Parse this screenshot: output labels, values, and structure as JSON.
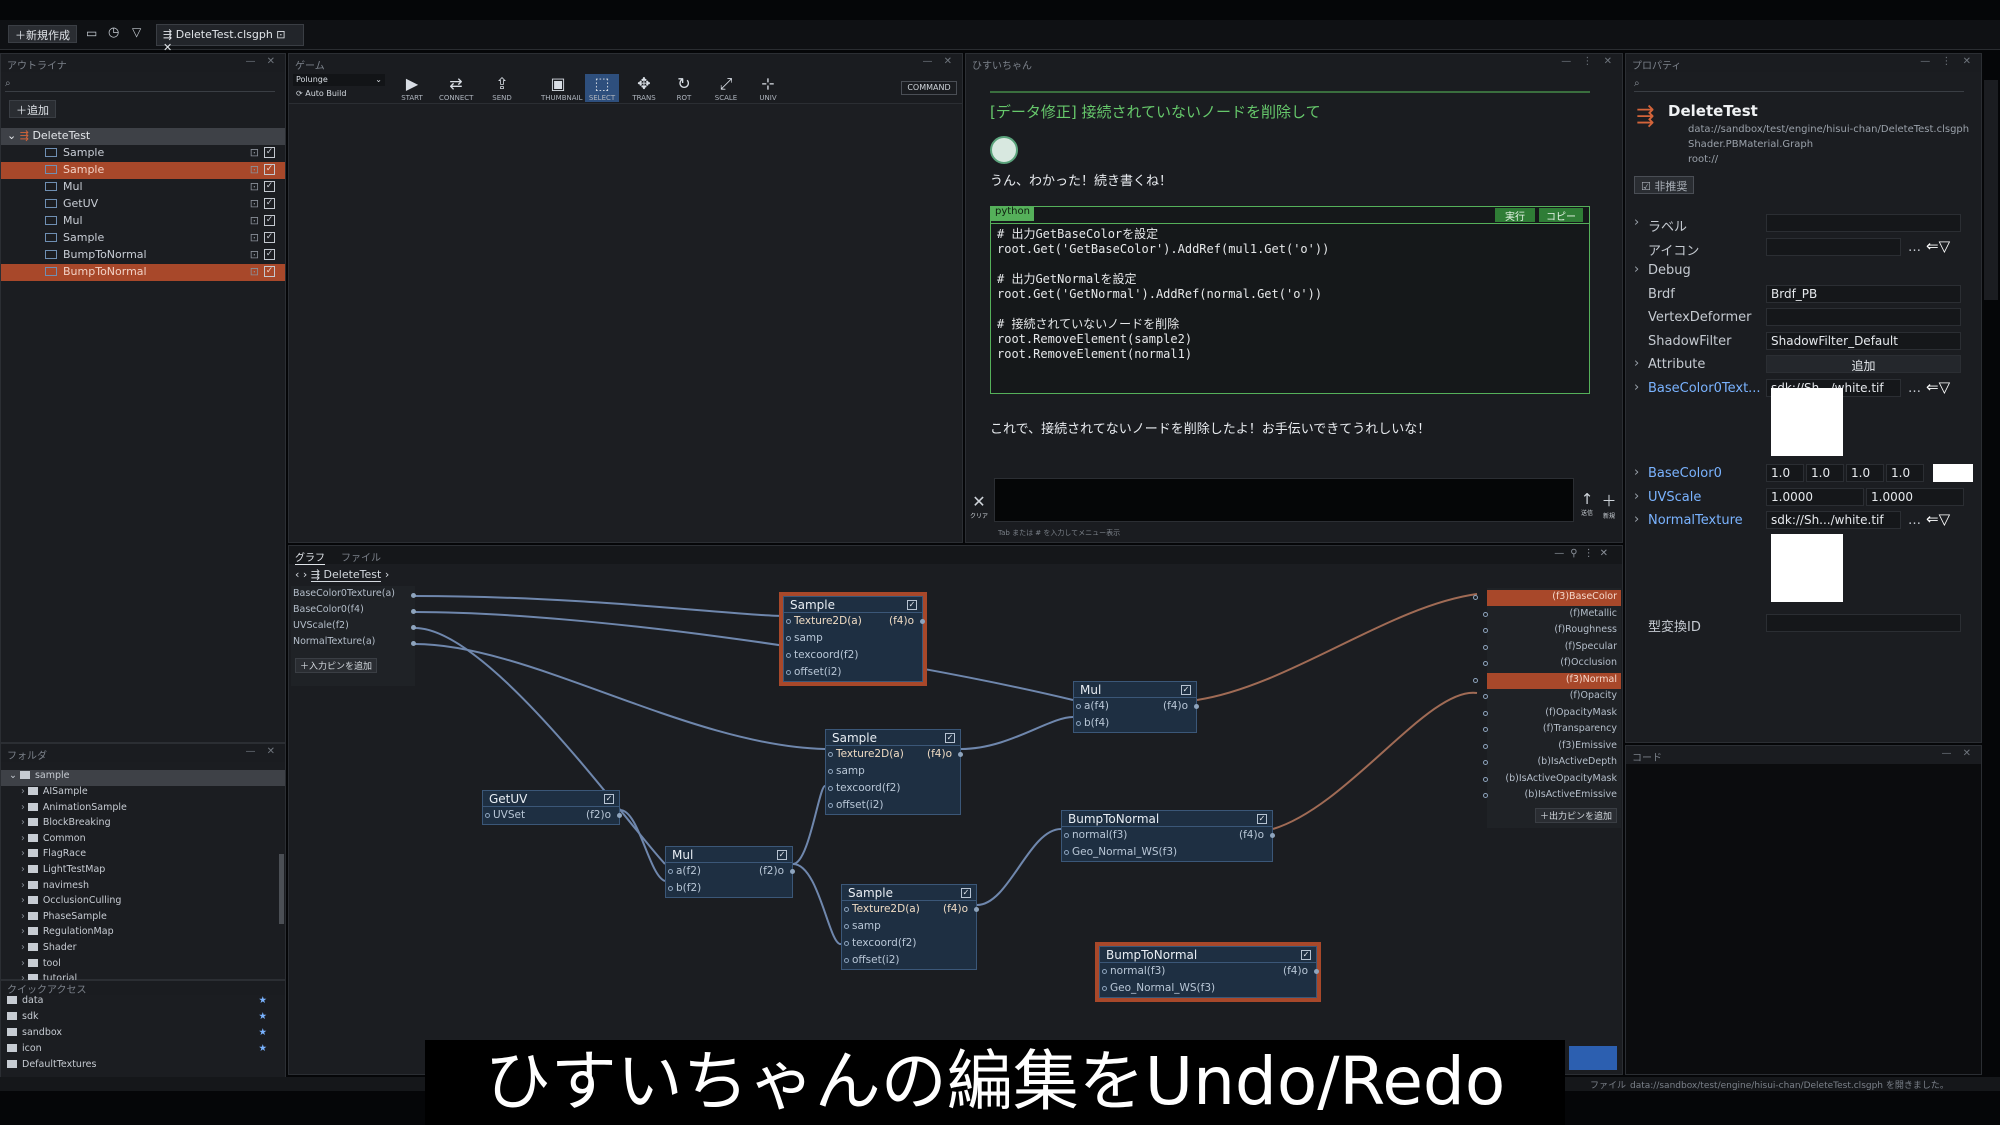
{
  "topbar": {
    "new_button": "新規作成",
    "tab_title": "DeleteTest.clsgph"
  },
  "outline": {
    "title": "アウトライナ",
    "add_button": "追加",
    "root": "DeleteTest",
    "items": [
      {
        "label": "Sample",
        "selected": false
      },
      {
        "label": "Sample",
        "selected": true
      },
      {
        "label": "Mul",
        "selected": false
      },
      {
        "label": "GetUV",
        "selected": false
      },
      {
        "label": "Mul",
        "selected": false
      },
      {
        "label": "Sample",
        "selected": false
      },
      {
        "label": "BumpToNormal",
        "selected": false
      },
      {
        "label": "BumpToNormal",
        "selected": true
      }
    ]
  },
  "game": {
    "title": "ゲーム",
    "platform": "Polunge",
    "auto_build": "Auto Build",
    "tools": [
      "START",
      "CONNECT",
      "SEND",
      "THUMBNAIL",
      "SELECT",
      "TRANS",
      "ROT",
      "SCALE",
      "UNIV"
    ],
    "command": "COMMAND"
  },
  "chat": {
    "title": "ひすいちゃん",
    "request": "[データ修正] 接続されていないノードを削除して",
    "reply1": "うん、わかった！続き書くね！",
    "code_lang": "python",
    "run_button": "実行",
    "copy_button": "コピー",
    "code": [
      "# 出力GetBaseColorを設定",
      "root.Get('GetBaseColor').AddRef(mul1.Get('o'))",
      "",
      "# 出力GetNormalを設定",
      "root.Get('GetNormal').AddRef(normal.Get('o'))",
      "",
      "# 接続されていないノードを削除",
      "root.RemoveElement(sample2)",
      "root.RemoveElement(normal1)"
    ],
    "reply2": "これで、接続されてないノードを削除したよ！お手伝いできてうれしいな！",
    "clear_label": "クリア",
    "send_label": "送信",
    "new_label": "新規",
    "input_hint": "Tab または # を入力してメニュー表示"
  },
  "properties": {
    "title": "プロパティ",
    "name": "DeleteTest",
    "path": "data://sandbox/test/engine/hisui-chan/DeleteTest.clsgph",
    "material": "Shader.PBMaterial.Graph",
    "root": "root://",
    "hide_button": "非推奨",
    "rows": [
      {
        "label": "ラベル",
        "value": ""
      },
      {
        "label": "アイコン",
        "value": ""
      },
      {
        "label": "Debug",
        "value": ""
      },
      {
        "label": "Brdf",
        "value": "Brdf_PB"
      },
      {
        "label": "VertexDeformer",
        "value": ""
      },
      {
        "label": "ShadowFilter",
        "value": "ShadowFilter_Default"
      },
      {
        "label": "Attribute",
        "value": "追加"
      },
      {
        "label": "BaseColor0Text...",
        "value": "sdk://Sh.../white.tif"
      }
    ],
    "basecolor_label": "BaseColor0",
    "basecolor_values": [
      "1.0",
      "1.0",
      "1.0",
      "1.0"
    ],
    "uvscale_label": "UVScale",
    "uvscale_values": [
      "1.0000",
      "1.0000"
    ],
    "normal_label": "NormalTexture",
    "normal_value": "sdk://Sh.../white.tif",
    "id_label": "型変換ID"
  },
  "code_panel": {
    "title": "コード"
  },
  "folder": {
    "title": "フォルダ",
    "root": "sample",
    "items": [
      "AISample",
      "AnimationSample",
      "BlockBreaking",
      "Common",
      "FlagRace",
      "LightTestMap",
      "navimesh",
      "OcclusionCulling",
      "PhaseSample",
      "RegulationMap",
      "Shader",
      "tool",
      "tutorial"
    ]
  },
  "quick": {
    "title": "クイックアクセス",
    "items": [
      "data",
      "sdk",
      "sandbox",
      "icon",
      "DefaultTextures"
    ]
  },
  "graph": {
    "tab_graph": "グラフ",
    "tab_file": "ファイル",
    "breadcrumb": "DeleteTest",
    "inputs": [
      "BaseColor0Texture(a)",
      "BaseColor0(f4)",
      "UVScale(f2)",
      "NormalTexture(a)"
    ],
    "add_input": "入力ピンを追加",
    "outputs": [
      {
        "label": "(f3)BaseColor",
        "hi": true
      },
      {
        "label": "(f)Metallic",
        "hi": false
      },
      {
        "label": "(f)Roughness",
        "hi": false
      },
      {
        "label": "(f)Specular",
        "hi": false
      },
      {
        "label": "(f)Occlusion",
        "hi": false
      },
      {
        "label": "(f3)Normal",
        "hi": true
      },
      {
        "label": "(f)Opacity",
        "hi": false
      },
      {
        "label": "(f)OpacityMask",
        "hi": false
      },
      {
        "label": "(f)Transparency",
        "hi": false
      },
      {
        "label": "(f3)Emissive",
        "hi": false
      },
      {
        "label": "(b)IsActiveDepth",
        "hi": false
      },
      {
        "label": "(b)IsActiveOpacityMask",
        "hi": false
      },
      {
        "label": "(b)IsActiveEmissive",
        "hi": false
      }
    ],
    "add_output": "出力ピンを追加",
    "nodes": {
      "sample1": {
        "title": "Sample",
        "rows": [
          "Texture2D(a)",
          "samp",
          "texcoord(f2)",
          "offset(i2)"
        ],
        "out": "(f4)o"
      },
      "sample2": {
        "title": "Sample",
        "rows": [
          "Texture2D(a)",
          "samp",
          "texcoord(f2)",
          "offset(i2)"
        ],
        "out": "(f4)o"
      },
      "sample3": {
        "title": "Sample",
        "rows": [
          "Texture2D(a)",
          "samp",
          "texcoord(f2)",
          "offset(i2)"
        ],
        "out": "(f4)o"
      },
      "mul1": {
        "title": "Mul",
        "rows": [
          "a(f4)",
          "b(f4)"
        ],
        "out": "(f4)o"
      },
      "mul2": {
        "title": "Mul",
        "rows": [
          "a(f2)",
          "b(f2)"
        ],
        "out": "(f2)o"
      },
      "getuv": {
        "title": "GetUV",
        "rows": [
          "UVSet"
        ],
        "out": "(f2)o"
      },
      "bump1": {
        "title": "BumpToNormal",
        "rows": [
          "normal(f3)",
          "Geo_Normal_WS(f3)"
        ],
        "out": "(f4)o"
      },
      "bump2": {
        "title": "BumpToNormal",
        "rows": [
          "normal(f3)",
          "Geo_Normal_WS(f3)"
        ],
        "out": "(f4)o"
      }
    }
  },
  "status": {
    "file_label": "ファイル",
    "text": "data://sandbox/test/engine/hisui-chan/DeleteTest.clsgph を開きました。"
  },
  "subtitle": "ひすいちゃんの編集をUndo/Redo"
}
